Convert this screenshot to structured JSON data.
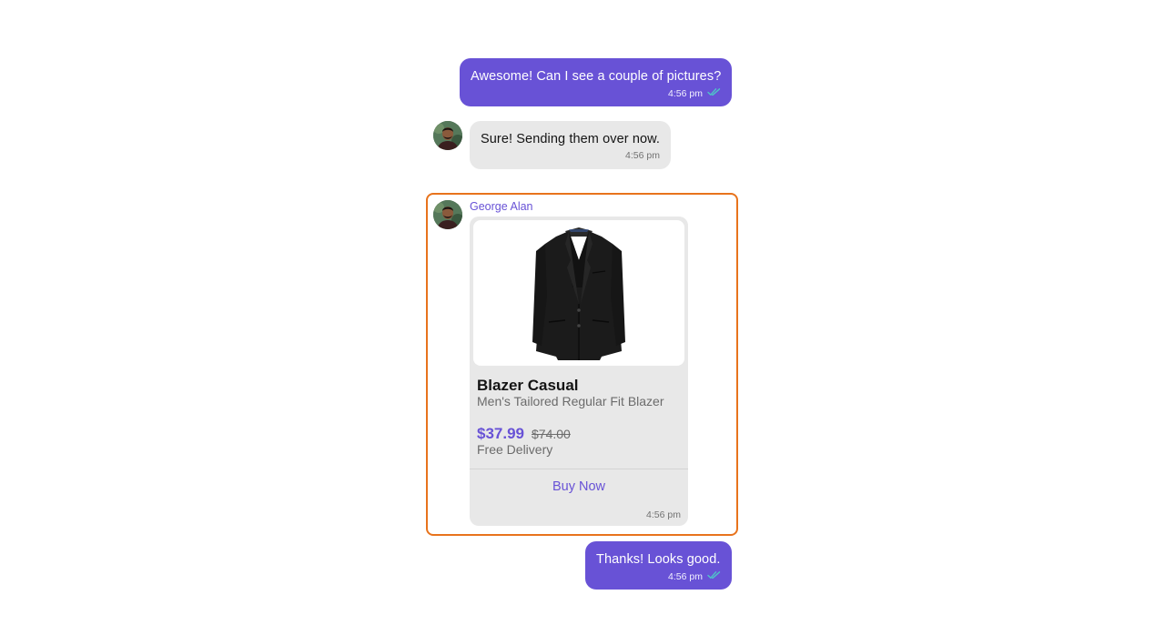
{
  "messages": [
    {
      "id": "m1",
      "direction": "outgoing",
      "text": "Awesome! Can I see a couple of pictures?",
      "time": "4:56 pm",
      "receipt_icon": "double-check-icon"
    },
    {
      "id": "m2",
      "direction": "incoming",
      "text": "Sure! Sending them over now.",
      "time": "4:56 pm",
      "avatar_icon": "user-avatar"
    },
    {
      "id": "m3",
      "direction": "incoming",
      "sender": "George Alan",
      "type": "product_card",
      "product": {
        "image_icon": "blazer-image",
        "title": "Blazer Casual",
        "subtitle": "Men's Tailored Regular Fit Blazer",
        "price": "$37.99",
        "original_price": "$74.00",
        "delivery": "Free Delivery",
        "cta_label": "Buy Now"
      },
      "time": "4:56 pm"
    },
    {
      "id": "m4",
      "direction": "outgoing",
      "text": "Thanks! Looks good.",
      "time": "4:56 pm",
      "receipt_icon": "double-check-icon"
    }
  ],
  "colors": {
    "accent": "#6852D6",
    "incoming_bubble": "#E8E8E8",
    "highlight_border": "#E8731C",
    "receipt_check": "#4FC3C8"
  }
}
